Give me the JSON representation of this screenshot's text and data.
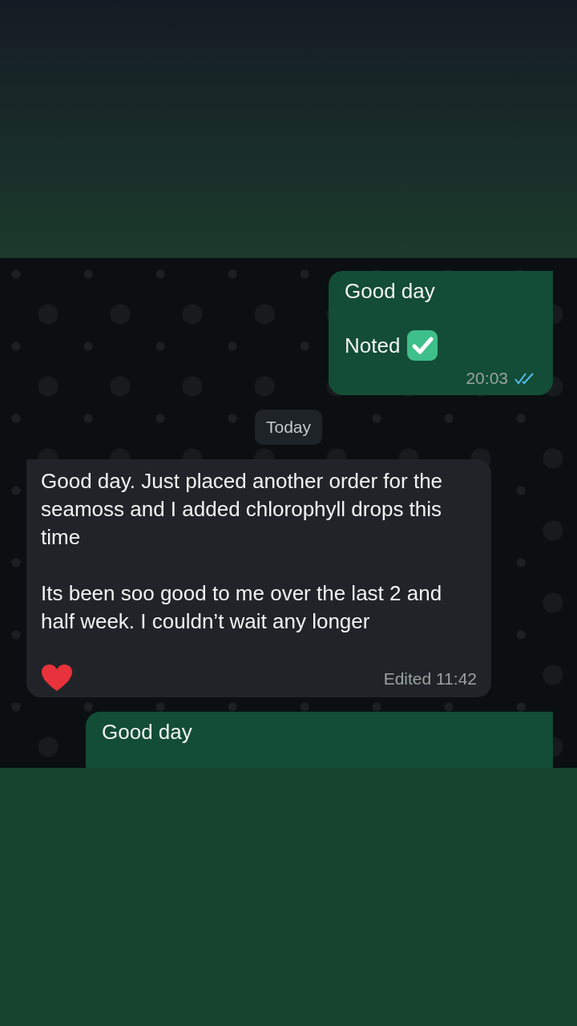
{
  "messages": [
    {
      "kind": "outgoing",
      "paragraphs": [
        "Good day",
        "Noted"
      ],
      "check_emoji": true,
      "time": "20:03",
      "read": true
    },
    {
      "kind": "date",
      "label": "Today"
    },
    {
      "kind": "incoming",
      "paragraphs": [
        "Good day. Just placed another order for the seamoss and I added chlorophyll drops this time",
        "Its been soo good to me over the last 2 and half week. I couldn’t wait any longer"
      ],
      "heart_emoji": true,
      "meta": "Edited 11:42"
    },
    {
      "kind": "outgoing",
      "paragraphs": [
        "Good day"
      ],
      "check_emoji": false
    }
  ]
}
